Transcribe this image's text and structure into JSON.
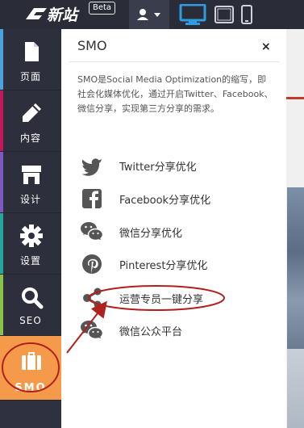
{
  "topbar": {
    "logo_text": "新站",
    "beta": "Beta"
  },
  "sidebar": {
    "items": [
      {
        "label": "页面",
        "icon": "page-icon",
        "strip": "#4aa3df"
      },
      {
        "label": "内容",
        "icon": "pencil-icon",
        "strip": "#c2185b"
      },
      {
        "label": "设计",
        "icon": "store-icon",
        "strip": "#7e57c2"
      },
      {
        "label": "设置",
        "icon": "gear-icon",
        "strip": "#26a69a"
      },
      {
        "label": "SEO",
        "icon": "search-icon",
        "strip": "#8bc34a"
      },
      {
        "label": "SMO",
        "icon": "briefcase-icon",
        "strip": "#f59a4a"
      }
    ]
  },
  "panel": {
    "title": "SMO",
    "close": "×",
    "description": "SMO是Social Media Optimization的缩写，即社会化媒体优化，通过开启Twitter、Facebook、微信分享，实现第三方分享的需求。",
    "items": [
      {
        "label": "Twitter分享优化",
        "icon": "twitter-icon"
      },
      {
        "label": "Facebook分享优化",
        "icon": "facebook-icon"
      },
      {
        "label": "微信分享优化",
        "icon": "wechat-icon"
      },
      {
        "label": "Pinterest分享优化",
        "icon": "pinterest-icon"
      },
      {
        "label": "运营专员一键分享",
        "icon": "share-icon"
      },
      {
        "label": "微信公众平台",
        "icon": "wechat-official-icon"
      }
    ]
  },
  "colors": {
    "accent": "#f59a4a",
    "device_active": "#2f9be0",
    "annotation": "#b0201c"
  }
}
